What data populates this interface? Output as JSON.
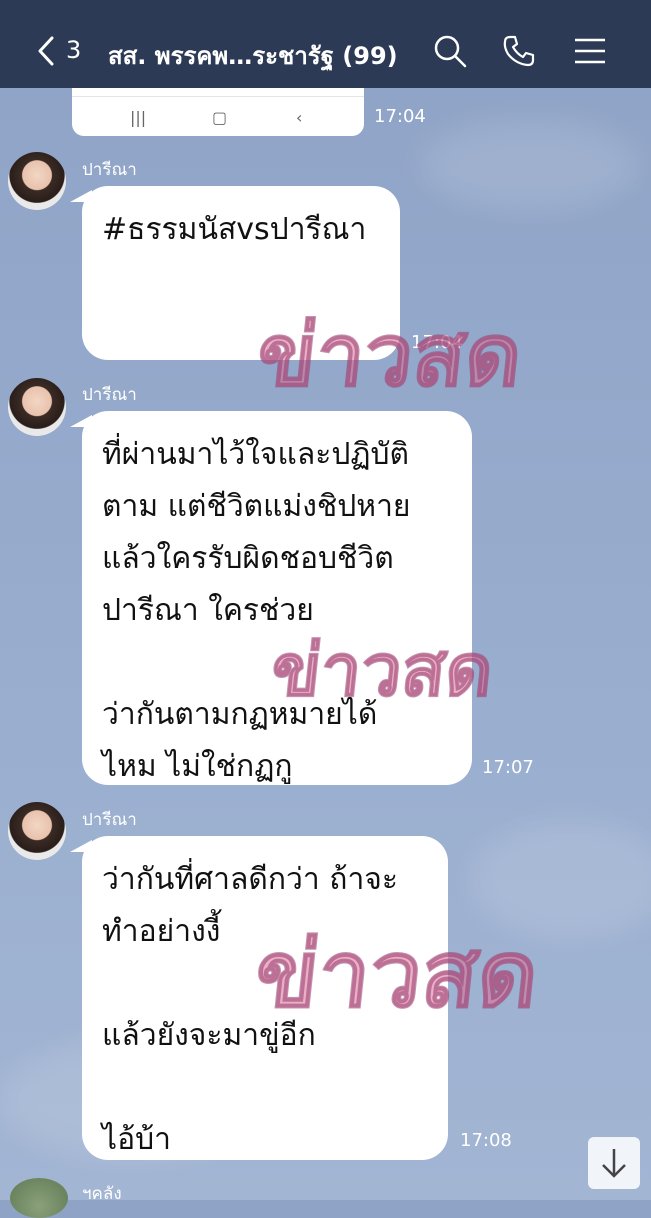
{
  "header": {
    "back_count": "3",
    "title": "สส. พรรคพ…ระชารัฐ (99)",
    "bg": "#2c3a55"
  },
  "messages": [
    {
      "sender": "ปารีณา",
      "text": "#ธรรมนัสvsปารีณา",
      "time": "17:04"
    },
    {
      "sender": "ปารีณา",
      "text": "ที่ผ่านมาไว้ใจและปฏิบัติ\nตาม แต่ชีวิตแม่งชิปหาย\nแล้วใครรับผิดชอบชีวิต\nปารีณา  ใครช่วย\n\nว่ากันตามกฏหมายได้\nไหม  ไม่ใช่กฏกู",
      "time": "17:07"
    },
    {
      "sender": "ปารีณา",
      "text": "ว่ากันที่ศาลดีกว่า  ถ้าจะ\nทำอย่างงี้\n\nแล้วยังจะมาขู่อีก\n\nไอ้บ้า",
      "time": "17:08"
    }
  ],
  "image_message": {
    "time": "17:04"
  },
  "next_sender": {
    "name": "ฯคลัง"
  },
  "watermark": {
    "text": "ข่าวสด"
  },
  "icons": {
    "back": "chevron-left-icon",
    "search": "search-icon",
    "call": "phone-icon",
    "menu": "hamburger-menu-icon",
    "scroll": "arrow-down-icon"
  }
}
